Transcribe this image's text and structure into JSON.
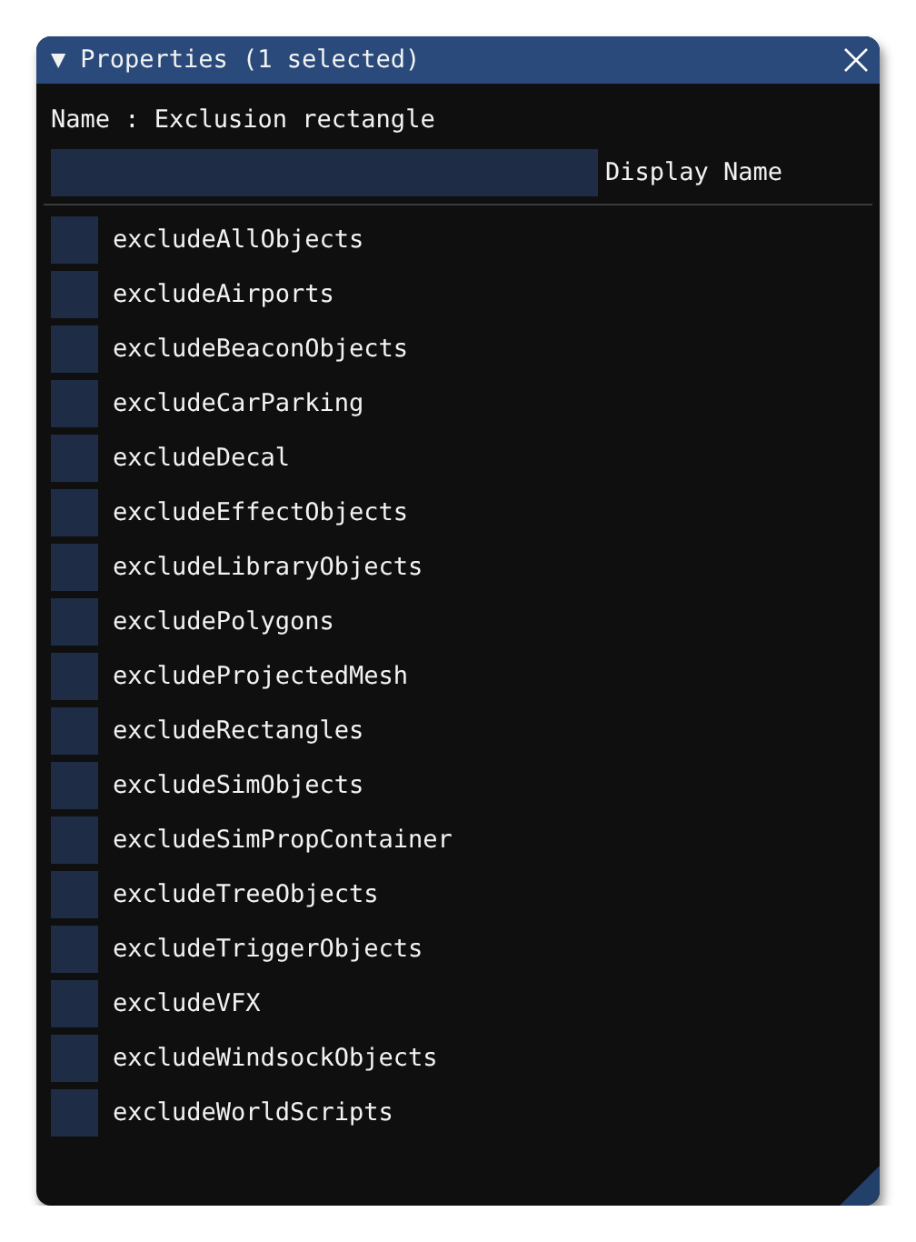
{
  "window": {
    "title": "Properties (1 selected)",
    "collapse_glyph": "▼"
  },
  "name_line": "Name : Exclusion rectangle",
  "display_name_field": {
    "label": "Display Name"
  },
  "options": [
    {
      "label": "excludeAllObjects",
      "checked": false
    },
    {
      "label": "excludeAirports",
      "checked": false
    },
    {
      "label": "excludeBeaconObjects",
      "checked": false
    },
    {
      "label": "excludeCarParking",
      "checked": false
    },
    {
      "label": "excludeDecal",
      "checked": false
    },
    {
      "label": "excludeEffectObjects",
      "checked": false
    },
    {
      "label": "excludeLibraryObjects",
      "checked": false
    },
    {
      "label": "excludePolygons",
      "checked": false
    },
    {
      "label": "excludeProjectedMesh",
      "checked": false
    },
    {
      "label": "excludeRectangles",
      "checked": false
    },
    {
      "label": "excludeSimObjects",
      "checked": false
    },
    {
      "label": "excludeSimPropContainer",
      "checked": false
    },
    {
      "label": "excludeTreeObjects",
      "checked": false
    },
    {
      "label": "excludeTriggerObjects",
      "checked": false
    },
    {
      "label": "excludeVFX",
      "checked": false
    },
    {
      "label": "excludeWindsockObjects",
      "checked": false
    },
    {
      "label": "excludeWorldScripts",
      "checked": false
    }
  ]
}
